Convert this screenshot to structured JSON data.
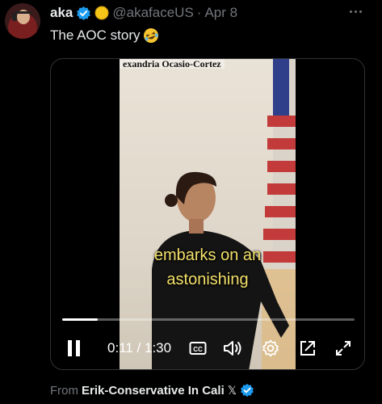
{
  "tweet": {
    "author_name": "aka",
    "handle": "@akafaceUS",
    "separator": "·",
    "date": "Apr 8",
    "text": "The AOC story"
  },
  "video": {
    "overlay_caption": "exandria Ocasio-Cortez",
    "subtitle_line1": "embarks on an",
    "subtitle_line2": "astonishing",
    "time_display": "0:11 / 1:30",
    "progress_fraction": 0.122,
    "cc_label": "CC"
  },
  "source": {
    "label": "From",
    "name": "Erik-Conservative In Cali",
    "platform_mark": "𝕏"
  },
  "colors": {
    "background": "#000000",
    "text_primary": "#e7e9ea",
    "text_secondary": "#71767b",
    "verified_blue": "#1d9bf0",
    "subtitle_yellow": "#f3e06a"
  },
  "icons": [
    "more-icon",
    "verified-icon",
    "emoji-face-icon",
    "laughing-emoji-icon",
    "pause-icon",
    "captions-icon",
    "volume-icon",
    "settings-icon",
    "pip-icon",
    "fullscreen-icon",
    "x-logo-icon"
  ]
}
